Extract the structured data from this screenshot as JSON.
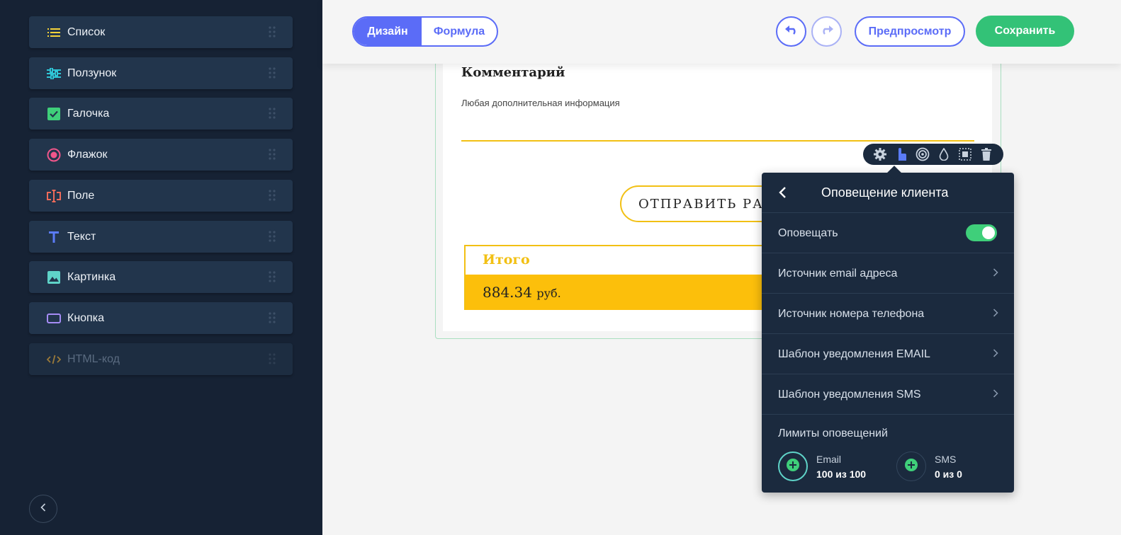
{
  "sidebar": {
    "items": [
      {
        "label": "Список",
        "icon": "list-icon"
      },
      {
        "label": "Ползунок",
        "icon": "slider-icon"
      },
      {
        "label": "Галочка",
        "icon": "checkbox-icon"
      },
      {
        "label": "Флажок",
        "icon": "radio-icon"
      },
      {
        "label": "Поле",
        "icon": "input-field-icon"
      },
      {
        "label": "Текст",
        "icon": "text-icon"
      },
      {
        "label": "Картинка",
        "icon": "image-icon"
      },
      {
        "label": "Кнопка",
        "icon": "button-icon"
      },
      {
        "label": "HTML-код",
        "icon": "code-icon"
      }
    ]
  },
  "toolbar": {
    "tab_design": "Дизайн",
    "tab_formula": "Формула",
    "preview_label": "Предпросмотр",
    "save_label": "Сохранить"
  },
  "form": {
    "comment_title": "Комментарий",
    "comment_placeholder": "Любая дополнительная информация",
    "submit_label": "ОТПРАВИТЬ РАСЧЕТ",
    "total_label": "Итого",
    "total_value": "884.34",
    "total_currency": "руб."
  },
  "panel": {
    "title": "Оповещение клиента",
    "notify_label": "Оповещать",
    "notify_enabled": true,
    "rows": [
      "Источник email адреса",
      "Источник номера телефона",
      "Шаблон уведомления EMAIL",
      "Шаблон уведомления SMS"
    ],
    "limits_title": "Лимиты оповещений",
    "limits": [
      {
        "name": "Email",
        "value": "100 из 100"
      },
      {
        "name": "SMS",
        "value": "0 из 0"
      }
    ]
  },
  "colors": {
    "accent": "#5b6cf7",
    "save": "#33c277",
    "form_accent": "#f2c014",
    "sidebar_bg": "#162234",
    "panel_bg": "#1b2a3e"
  }
}
